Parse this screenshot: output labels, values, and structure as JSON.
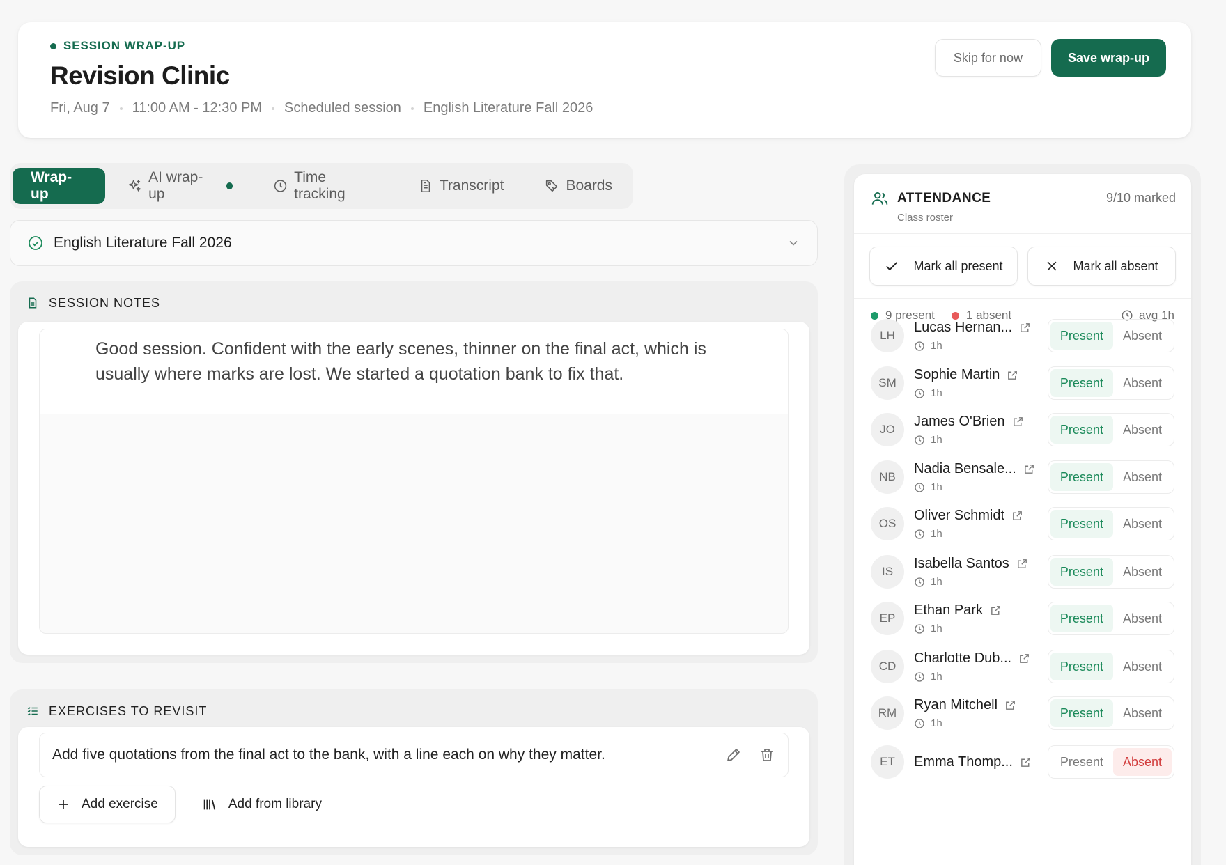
{
  "header": {
    "kicker": "SESSION WRAP-UP",
    "title": "Revision Clinic",
    "date": "Fri, Aug 7",
    "time": "11:00 AM - 12:30 PM",
    "type": "Scheduled session",
    "course": "English Literature Fall 2026",
    "skip_label": "Skip for now",
    "save_label": "Save wrap-up"
  },
  "tabs": {
    "wrapup": "Wrap-up",
    "ai": "AI wrap-up",
    "time": "Time tracking",
    "transcript": "Transcript",
    "boards": "Boards"
  },
  "course_select": {
    "value": "English Literature Fall 2026"
  },
  "notes": {
    "heading": "SESSION NOTES",
    "text": "Good session. Confident with the early scenes, thinner on the final act, which is usually where marks are lost. We started a quotation bank to fix that."
  },
  "exercises": {
    "heading": "EXERCISES TO REVISIT",
    "items": [
      "Add five quotations from the final act to the bank, with a line each on why they matter."
    ],
    "add_label": "Add exercise",
    "library_label": "Add from library"
  },
  "attendance": {
    "title": "ATTENDANCE",
    "subtitle": "Class roster",
    "count": "9/10 marked",
    "mark_present": "Mark all present",
    "mark_absent": "Mark all absent",
    "present_summary": "9 present",
    "absent_summary": "1 absent",
    "avg": "avg 1h",
    "present_label": "Present",
    "absent_label": "Absent",
    "students": [
      {
        "initials": "LH",
        "name": "Lucas Hernan...",
        "time": "1h",
        "status": "present"
      },
      {
        "initials": "SM",
        "name": "Sophie Martin",
        "time": "1h",
        "status": "present"
      },
      {
        "initials": "JO",
        "name": "James O'Brien",
        "time": "1h",
        "status": "present"
      },
      {
        "initials": "NB",
        "name": "Nadia Bensale...",
        "time": "1h",
        "status": "present"
      },
      {
        "initials": "OS",
        "name": "Oliver Schmidt",
        "time": "1h",
        "status": "present"
      },
      {
        "initials": "IS",
        "name": "Isabella Santos",
        "time": "1h",
        "status": "present"
      },
      {
        "initials": "EP",
        "name": "Ethan Park",
        "time": "1h",
        "status": "present"
      },
      {
        "initials": "CD",
        "name": "Charlotte Dub...",
        "time": "1h",
        "status": "present"
      },
      {
        "initials": "RM",
        "name": "Ryan Mitchell",
        "time": "1h",
        "status": "present"
      },
      {
        "initials": "ET",
        "name": "Emma Thomp...",
        "time": "",
        "status": "absent"
      }
    ]
  },
  "icons": {
    "kicker_dot": "status-dot",
    "tab_ai": "sparkles-icon",
    "tab_time": "clock-icon",
    "tab_transcript": "document-icon",
    "tab_boards": "tag-icon",
    "select": "check-circle-icon",
    "notes": "notes-icon",
    "exercises": "checklist-icon",
    "attendance": "users-icon"
  },
  "colors": {
    "accent": "#156b4f",
    "present": "#1b8a5a",
    "absent": "#d23d3d"
  }
}
